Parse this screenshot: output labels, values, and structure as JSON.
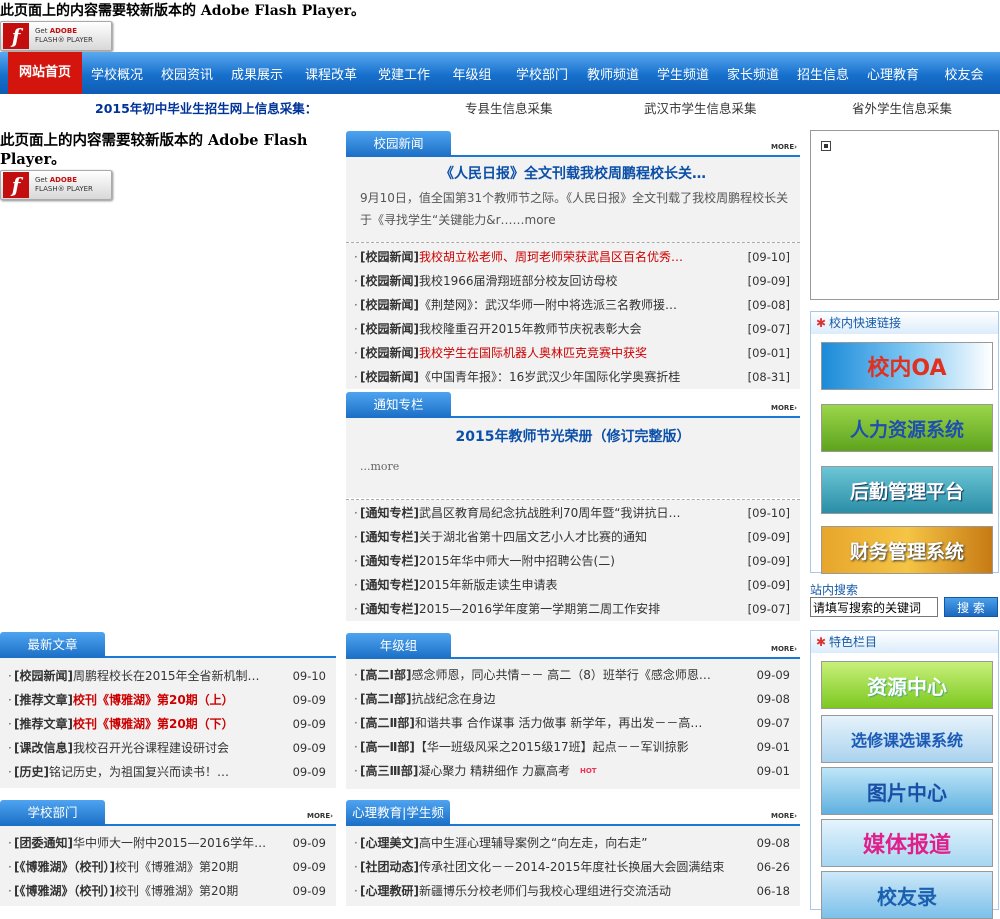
{
  "flash": {
    "message": "此页面上的内容需要较新版本的 Adobe Flash Player。",
    "btn_line1": "Get ",
    "btn_adobe": "ADOBE",
    "btn_line2": "FLASH® PLAYER"
  },
  "nav": {
    "items": [
      "网站首页",
      "学校概况",
      "校园资讯",
      "成果展示",
      "课程改革",
      "党建工作",
      "年级组",
      "学校部门",
      "教师频道",
      "学生频道",
      "家长频道",
      "招生信息",
      "心理教育",
      "校友会"
    ]
  },
  "info_bar": {
    "title": "2015年初中毕业生招生网上信息采集：",
    "links": [
      "专县生信息采集",
      "武汉市学生信息采集",
      "省外学生信息采集"
    ]
  },
  "more_label": "MORE›",
  "campus_news": {
    "tab": "校园新闻",
    "headline": "《人民日报》全文刊载我校周鹏程校长关…",
    "summary": "9月10日，值全国第31个教师节之际。《人民日报》全文刊载了我校周鹏程校长关于《寻找学生“关键能力&r……more",
    "items": [
      {
        "cat": "[校园新闻]",
        "title": "我校胡立松老师、周珂老师荣获武昌区百名优秀…",
        "date": "[09-10]",
        "red": true
      },
      {
        "cat": "[校园新闻]",
        "title": "我校1966届滑翔班部分校友回访母校",
        "date": "[09-09]",
        "red": false
      },
      {
        "cat": "[校园新闻]",
        "title": "《荆楚网》：武汉华师一附中将选派三名教师援…",
        "date": "[09-08]",
        "red": false
      },
      {
        "cat": "[校园新闻]",
        "title": "我校隆重召开2015年教师节庆祝表彰大会",
        "date": "[09-07]",
        "red": false
      },
      {
        "cat": "[校园新闻]",
        "title": "我校学生在国际机器人奥林匹克竞赛中获奖",
        "date": "[09-01]",
        "red": true
      },
      {
        "cat": "[校园新闻]",
        "title": "《中国青年报》：16岁武汉少年国际化学奥赛折桂",
        "date": "[08-31]",
        "red": false
      }
    ]
  },
  "notice": {
    "tab": "通知专栏",
    "headline": "2015年教师节光荣册（修订完整版）",
    "more_text": "...more",
    "items": [
      {
        "cat": "[通知专栏]",
        "title": "武昌区教育局纪念抗战胜利70周年暨“我讲抗日…",
        "date": "[09-10]"
      },
      {
        "cat": "[通知专栏]",
        "title": "关于湖北省第十四届文艺小人才比赛的通知",
        "date": "[09-09]"
      },
      {
        "cat": "[通知专栏]",
        "title": "2015年华中师大一附中招聘公告(二)",
        "date": "[09-09]"
      },
      {
        "cat": "[通知专栏]",
        "title": "2015年新版走读生申请表",
        "date": "[09-09]"
      },
      {
        "cat": "[通知专栏]",
        "title": "2015—2016学年度第一学期第二周工作安排",
        "date": "[09-07]"
      }
    ]
  },
  "latest": {
    "tab": "最新文章",
    "items": [
      {
        "cat": "[校园新闻]",
        "title": "周鹏程校长在2015年全省新机制…",
        "date": "09-10",
        "style": ""
      },
      {
        "cat": "[推荐文章]",
        "title": "校刊《博雅湖》第20期（上）",
        "date": "09-09",
        "style": "bold-red"
      },
      {
        "cat": "[推荐文章]",
        "title": "校刊《博雅湖》第20期（下）",
        "date": "09-09",
        "style": "bold-red"
      },
      {
        "cat": "[课改信息]",
        "title": "我校召开光谷课程建设研讨会",
        "date": "09-09",
        "style": ""
      },
      {
        "cat": "[历史]",
        "title": "铭记历史，为祖国复兴而读书！…",
        "date": "09-09",
        "style": ""
      }
    ]
  },
  "grade": {
    "tab": "年级组",
    "items": [
      {
        "cat": "[高二Ⅰ部]",
        "title": "感念师恩，同心共情－－ 高二（8）班举行《感念师恩…",
        "date": "09-09",
        "hot": false
      },
      {
        "cat": "[高二Ⅰ部]",
        "title": "抗战纪念在身边",
        "date": "09-08",
        "hot": false
      },
      {
        "cat": "[高二Ⅱ部]",
        "title": "和谐共事 合作谋事 活力做事 新学年，再出发－－高…",
        "date": "09-07",
        "hot": false
      },
      {
        "cat": "[高一Ⅱ部]",
        "title": "【华一班级风采之2015级17班】起点－－军训掠影",
        "date": "09-01",
        "hot": false
      },
      {
        "cat": "[高三Ⅲ部]",
        "title": "凝心聚力 精耕细作 力赢高考",
        "date": "09-01",
        "hot": true
      }
    ],
    "hot_label": "HOT"
  },
  "dept": {
    "tab": "学校部门",
    "items": [
      {
        "cat": "[团委通知]",
        "title": "华中师大一附中2015—2016学年…",
        "date": "09-09"
      },
      {
        "cat": "[《博雅湖》（校刊）]",
        "title": "校刊《博雅湖》第20期",
        "date": "09-09"
      },
      {
        "cat": "[《博雅湖》（校刊）]",
        "title": "校刊《博雅湖》第20期",
        "date": "09-09"
      }
    ]
  },
  "psych": {
    "tab": "心理教育|学生频道",
    "items": [
      {
        "cat": "[心理美文]",
        "title": "高中生涯心理辅导案例之“向左走，向右走”",
        "date": "09-08"
      },
      {
        "cat": "[社团动态]",
        "title": "传承社团文化－－2014-2015年度社长换届大会圆满结束",
        "date": "06-26"
      },
      {
        "cat": "[心理教研]",
        "title": "新疆博乐分校老师们与我校心理组进行交流活动",
        "date": "06-18"
      }
    ]
  },
  "quick_links": {
    "title": "校内快速链接",
    "items": [
      "校内OA",
      "人力资源系统",
      "后勤管理平台",
      "财务管理系统"
    ]
  },
  "search": {
    "label": "站内搜索",
    "placeholder": "请填写搜索的关键词",
    "button": "搜 索"
  },
  "featured": {
    "title": "特色栏目",
    "items": [
      "资源中心",
      "选修课选课系统",
      "图片中心",
      "媒体报道",
      "校友录"
    ]
  }
}
